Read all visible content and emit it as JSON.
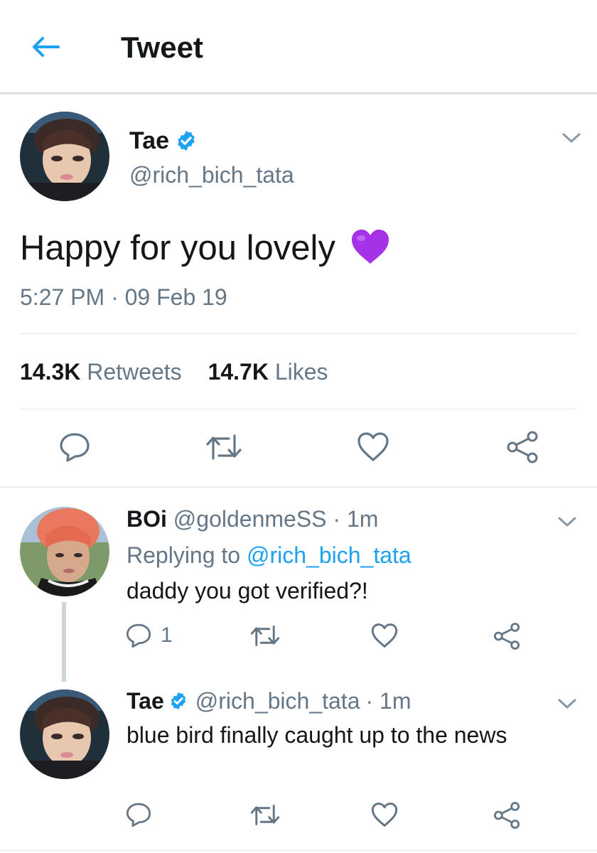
{
  "header": {
    "title": "Tweet",
    "back_icon": "arrow-left-icon"
  },
  "main_tweet": {
    "author_name": "Tae",
    "handle": "@rich_bich_tata",
    "text": "Happy for you lovely",
    "emoji": "💜",
    "timestamp": "5:27 PM · 09 Feb 19",
    "retweets_count": "14.3K",
    "retweets_label": "Retweets",
    "likes_count": "14.7K",
    "likes_label": "Likes"
  },
  "replies": [
    {
      "author_name": "BOi",
      "handle": "@goldenmeSS",
      "time": "· 1m",
      "replying_label": "Replying to",
      "replying_handle": "@rich_bich_tata",
      "text": "daddy you got verified?!",
      "reply_count": "1"
    },
    {
      "author_name": "Tae",
      "handle": "@rich_bich_tata",
      "time": "· 1m",
      "text": "blue bird finally caught up to the news"
    }
  ],
  "colors": {
    "accent": "#1da1f2",
    "muted": "#657786",
    "text": "#14171a",
    "divider": "#e1e8ed"
  }
}
